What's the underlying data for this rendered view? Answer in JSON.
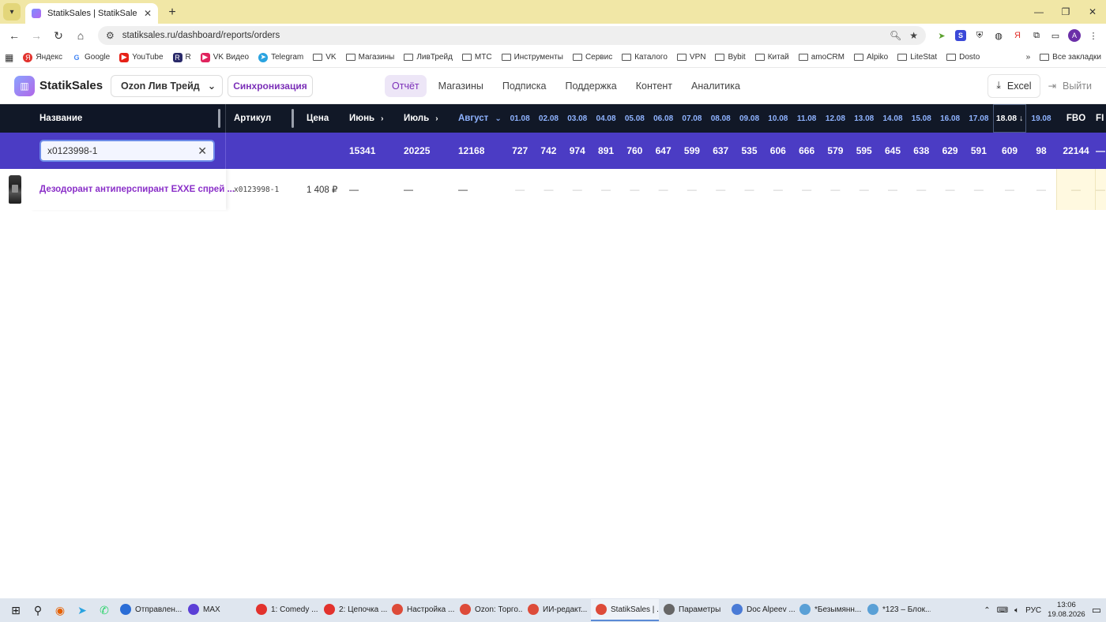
{
  "browser": {
    "tab_title": "StatikSales | StatikSales",
    "url": "statiksales.ru/dashboard/reports/orders",
    "bookmarks": [
      "Яндекс",
      "Google",
      "YouTube",
      "R",
      "VK Видео",
      "Telegram",
      "VK",
      "Магазины",
      "ЛивТрейд",
      "МТС",
      "Инструменты",
      "Сервис",
      "Каталого",
      "VPN",
      "Bybit",
      "Китай",
      "amoCRM",
      "Alpiko",
      "LiteStat",
      "Dosto"
    ],
    "all_bookmarks": "Все закладки",
    "profile_letter": "A"
  },
  "header": {
    "logo_text": "StatikSales",
    "shop": "Ozon Лив Трейд",
    "sync_label": "Синхронизация",
    "nav": [
      "Отчёт",
      "Магазины",
      "Подписка",
      "Поддержка",
      "Контент",
      "Аналитика"
    ],
    "excel_label": "Excel",
    "logout_label": "Выйти"
  },
  "table": {
    "columns": {
      "name": "Название",
      "article": "Артикул",
      "price": "Цена",
      "june": "Июнь",
      "july": "Июль",
      "august": "Август",
      "days": [
        "01.08",
        "02.08",
        "03.08",
        "04.08",
        "05.08",
        "06.08",
        "07.08",
        "08.08",
        "09.08",
        "10.08",
        "11.08",
        "12.08",
        "13.08",
        "14.08",
        "15.08",
        "16.08",
        "17.08"
      ],
      "day18": "18.08 ↓",
      "day19": "19.08",
      "fbo": "FBO",
      "fbs": "FI"
    },
    "search_value": "x0123998-1",
    "totals": {
      "june": "15341",
      "july": "20225",
      "august": "12168",
      "days": [
        "727",
        "742",
        "974",
        "891",
        "760",
        "647",
        "599",
        "637",
        "535",
        "606",
        "666",
        "579",
        "595",
        "645",
        "638",
        "629",
        "591"
      ],
      "day18": "609",
      "day19": "98",
      "fbo": "22144",
      "fbs": "—"
    },
    "row": {
      "name": "Дезодорант антиперспирант EXXE спрей ...",
      "article": "x0123998-1",
      "price": "1 408 ₽",
      "june": "—",
      "july": "—",
      "august": "—",
      "dash": "—"
    }
  },
  "taskbar": {
    "apps": [
      "Отправлен...",
      "MAX",
      "1: Comedy ...",
      "2: Цепочка ...",
      "Настройка ...",
      "Ozon: Торго...",
      "ИИ-редакт...",
      "StatikSales | ...",
      "Параметры",
      "Doc Alpeev ...",
      "*Безымянн...",
      "*123 – Блок..."
    ],
    "lang": "РУС",
    "time": "13:06",
    "date": "19.08.2026"
  }
}
